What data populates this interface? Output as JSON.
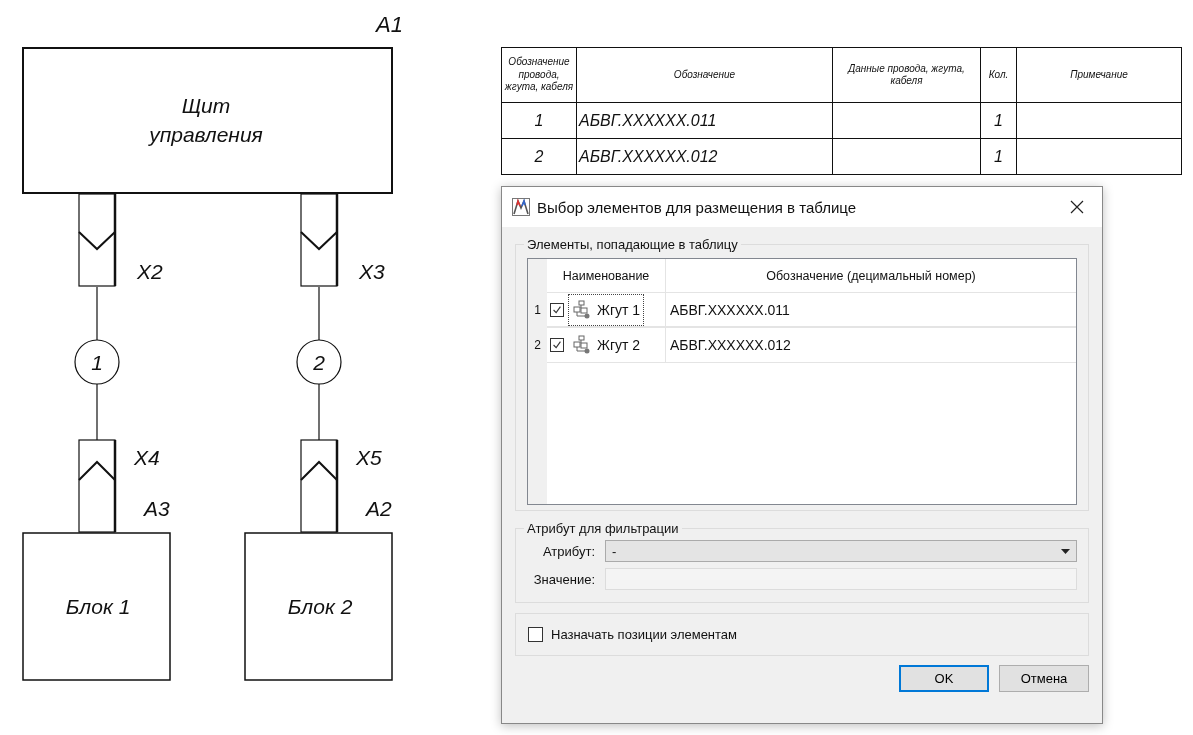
{
  "diagram": {
    "panel": {
      "designator": "A1",
      "name": [
        "Щит",
        "управления"
      ]
    },
    "branches": [
      {
        "top_connector": "X2",
        "wire": "1",
        "bottom_connector": "X4",
        "block_designator": "A3",
        "block_name": "Блок 1"
      },
      {
        "top_connector": "X3",
        "wire": "2",
        "bottom_connector": "X5",
        "block_designator": "A2",
        "block_name": "Блок 2"
      }
    ]
  },
  "table": {
    "columns": [
      "Обозначение провода, жгута, кабеля",
      "Обозначение",
      "Данные провода, жгута, кабеля",
      "Кол.",
      "Примечание"
    ],
    "rows": [
      [
        "1",
        "АБВГ.XXXXXX.011",
        "",
        "1",
        ""
      ],
      [
        "2",
        "АБВГ.XXXXXX.012",
        "",
        "1",
        ""
      ]
    ]
  },
  "dialog": {
    "title": "Выбор элементов для размещения в таблице",
    "elements_group": {
      "title": "Элементы, попадающие в таблицу",
      "columns": [
        "Наименование",
        "Обозначение (децимальный номер)"
      ],
      "rows": [
        {
          "number": "1",
          "checked": true,
          "name": "Жгут 1",
          "designation": "АБВГ.XXXXXX.011",
          "focused": true
        },
        {
          "number": "2",
          "checked": true,
          "name": "Жгут 2",
          "designation": "АБВГ.XXXXXX.012",
          "focused": false
        }
      ]
    },
    "filter_group": {
      "title": "Атрибут для фильтрации",
      "attribute_label": "Атрибут:",
      "attribute_value": "-",
      "value_label": "Значение:"
    },
    "assign_positions": {
      "label": "Назначать позиции элементам",
      "checked": false
    },
    "buttons": [
      {
        "label": "OK",
        "default": true
      },
      {
        "label": "Отмена",
        "default": false
      }
    ]
  }
}
